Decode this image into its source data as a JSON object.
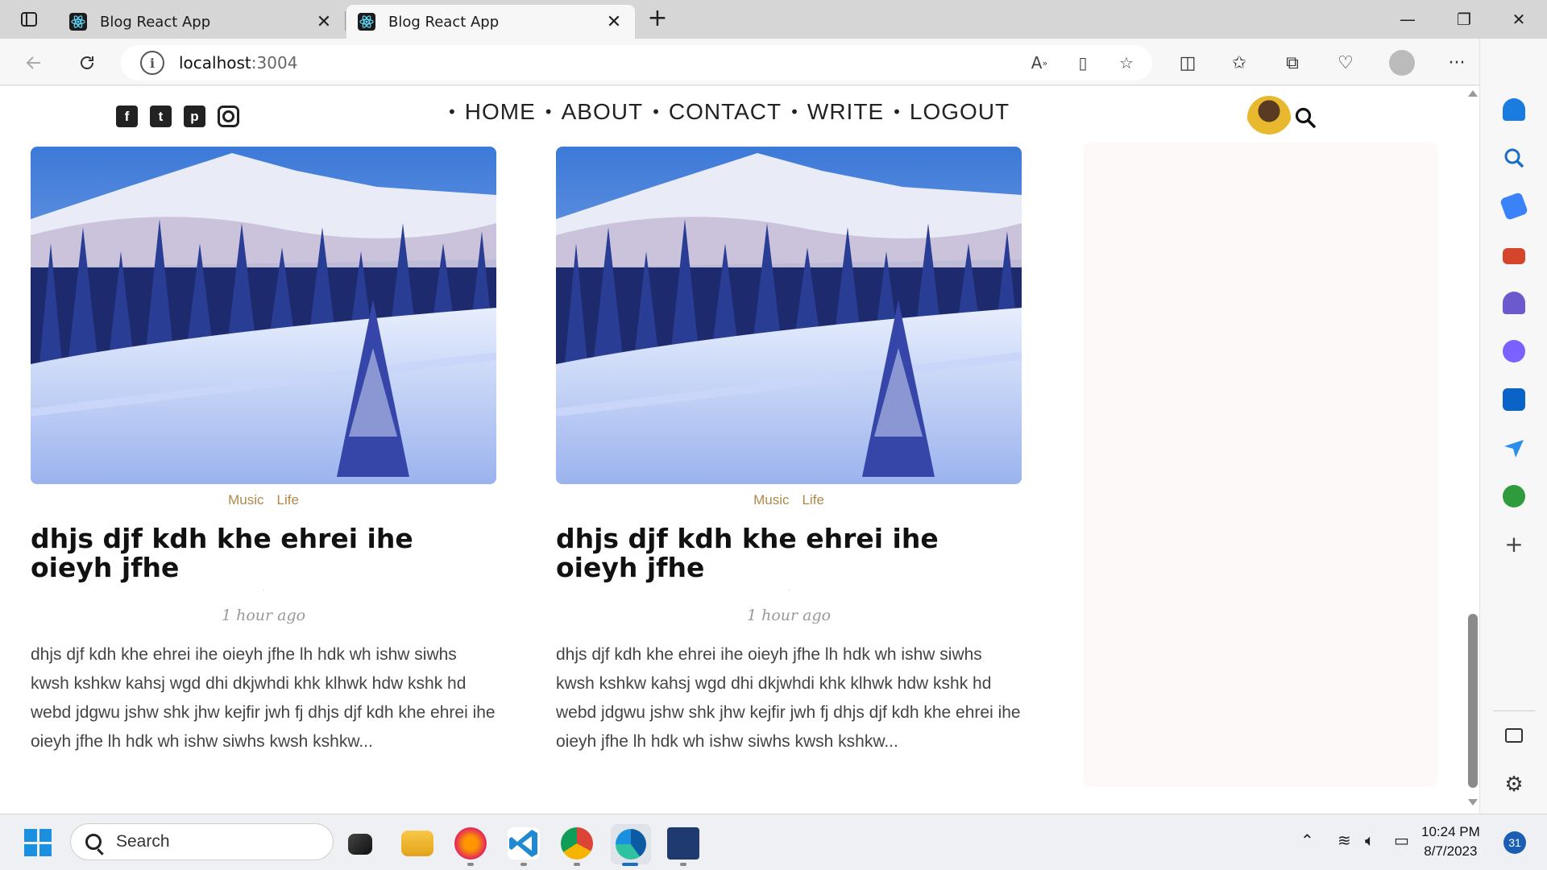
{
  "browser": {
    "tabs": [
      {
        "title": "Blog React App",
        "active": false
      },
      {
        "title": "Blog React App",
        "active": true
      }
    ],
    "new_tab_label": "+",
    "window_controls": {
      "minimize": "—",
      "restore": "❐",
      "close": "✕"
    },
    "address": {
      "host": "localhost",
      "port": ":3004"
    }
  },
  "site": {
    "social_icons": [
      "facebook-icon",
      "twitter-icon",
      "pinterest-icon",
      "instagram-icon"
    ],
    "social_glyphs": {
      "facebook": "f",
      "twitter": "t",
      "pinterest": "p"
    },
    "menu_bullet": "•",
    "menu": [
      "HOME",
      "ABOUT",
      "CONTACT",
      "WRITE",
      "LOGOUT"
    ]
  },
  "posts": [
    {
      "categories": [
        "Music",
        "Life"
      ],
      "title": "dhjs djf kdh khe ehrei ihe oieyh jfhe",
      "dot": ".",
      "date": "1 hour ago",
      "description": "dhjs djf kdh khe ehrei ihe oieyh jfhe lh hdk wh ishw siwhs kwsh kshkw kahsj wgd dhi dkjwhdi khk klhwk hdw kshk hd webd jdgwu jshw shk jhw kejfir jwh fj dhjs djf kdh khe ehrei ihe oieyh jfhe lh hdk wh ishw siwhs kwsh kshkw..."
    },
    {
      "categories": [
        "Music",
        "Life"
      ],
      "title": "dhjs djf kdh khe ehrei ihe oieyh jfhe",
      "dot": ".",
      "date": "1 hour ago",
      "description": "dhjs djf kdh khe ehrei ihe oieyh jfhe lh hdk wh ishw siwhs kwsh kshkw kahsj wgd dhi dkjwhdi khk klhwk hdw kshk hd webd jdgwu jshw shk jhw kejfir jwh fj dhjs djf kdh khe ehrei ihe oieyh jfhe lh hdk wh ishw siwhs kwsh kshkw..."
    }
  ],
  "taskbar": {
    "search_placeholder": "Search",
    "time": "10:24 PM",
    "date": "8/7/2023",
    "notification_count": "31"
  },
  "colors": {
    "category": "#b0894a",
    "accent": "#1b8fe0"
  }
}
